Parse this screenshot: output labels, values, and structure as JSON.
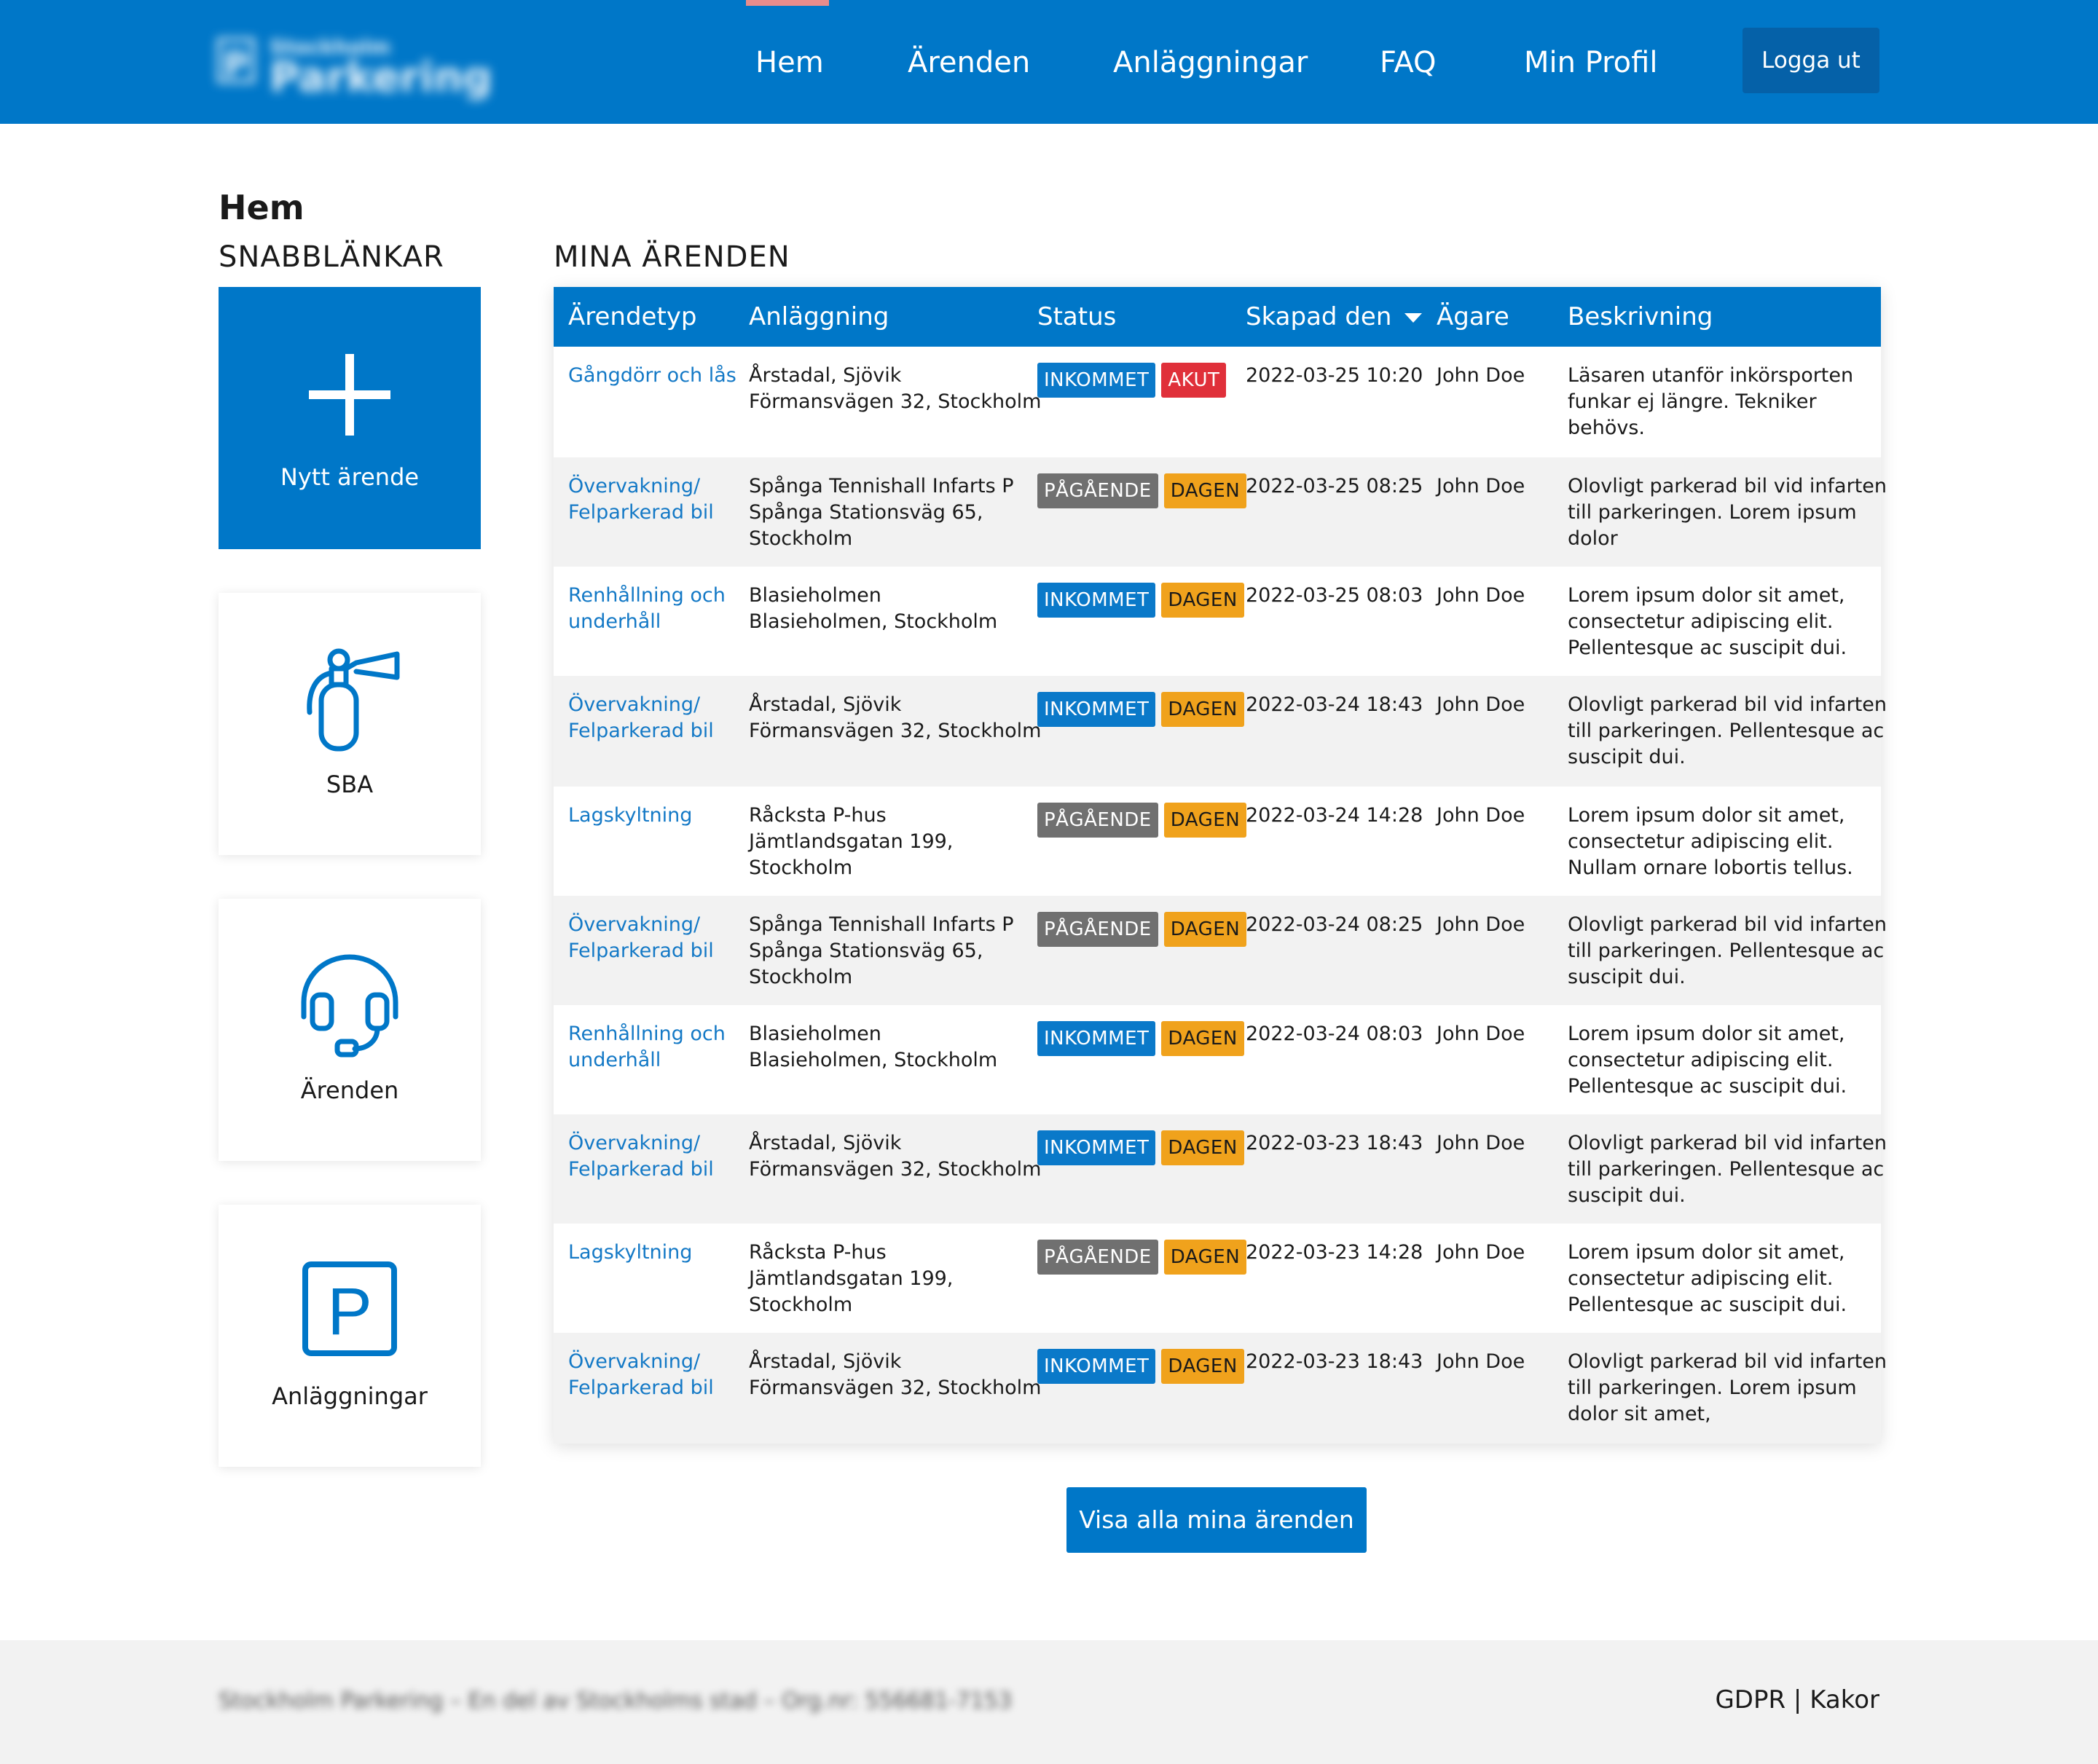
{
  "header": {
    "logo_small": "Stockholm",
    "logo_big": "Parkering",
    "logo_letter": "P",
    "nav": [
      {
        "label": "Hem",
        "active": true
      },
      {
        "label": "Ärenden"
      },
      {
        "label": "Anläggningar"
      },
      {
        "label": "FAQ"
      },
      {
        "label": "Min Profil"
      }
    ],
    "logout_label": "Logga ut"
  },
  "page": {
    "title": "Hem",
    "quicklinks_title": "SNABBLÄNKAR",
    "cases_title": "MINA ÄRENDEN"
  },
  "quicklinks": [
    {
      "label": "Nytt ärende",
      "icon": "plus-icon"
    },
    {
      "label": "SBA",
      "icon": "fire-extinguisher-icon"
    },
    {
      "label": "Ärenden",
      "icon": "headset-icon"
    },
    {
      "label": "Anläggningar",
      "icon": "parking-icon"
    }
  ],
  "table": {
    "headers": [
      "Ärendetyp",
      "Anläggning",
      "Status",
      "Skapad den",
      "Ägare",
      "Beskrivning"
    ],
    "sort_column": "Skapad den",
    "rows": [
      {
        "type": [
          "Gångdörr och lås"
        ],
        "facility": [
          "Årstadal, Sjövik",
          "Förmansvägen 32, Stockholm"
        ],
        "status": "INKOMMET",
        "priority": "AKUT",
        "created": "2022-03-25 10:20",
        "owner": "John Doe",
        "desc": [
          "Läsaren utanför inkörsporten",
          "funkar ej längre. Tekniker",
          "behövs."
        ]
      },
      {
        "type": [
          "Övervakning/",
          "Felparkerad bil"
        ],
        "facility": [
          "Spånga Tennishall Infarts P",
          "Spånga Stationsväg 65,",
          "Stockholm"
        ],
        "status": "PÅGÅENDE",
        "priority": "DAGEN",
        "created": "2022-03-25 08:25",
        "owner": "John Doe",
        "desc": [
          "Olovligt parkerad bil vid infarten",
          "till parkeringen. Lorem ipsum",
          "dolor"
        ]
      },
      {
        "type": [
          "Renhållning och",
          "underhåll"
        ],
        "facility": [
          "Blasieholmen",
          "Blasieholmen, Stockholm"
        ],
        "status": "INKOMMET",
        "priority": "DAGEN",
        "created": "2022-03-25 08:03",
        "owner": "John Doe",
        "desc": [
          "Lorem ipsum dolor sit amet,",
          "consectetur adipiscing elit.",
          "Pellentesque ac suscipit dui."
        ]
      },
      {
        "type": [
          "Övervakning/",
          "Felparkerad bil"
        ],
        "facility": [
          "Årstadal, Sjövik",
          "Förmansvägen 32, Stockholm"
        ],
        "status": "INKOMMET",
        "priority": "DAGEN",
        "created": "2022-03-24 18:43",
        "owner": "John Doe",
        "desc": [
          "Olovligt parkerad bil vid infarten",
          "till parkeringen. Pellentesque ac",
          "suscipit dui."
        ]
      },
      {
        "type": [
          "Lagskyltning"
        ],
        "facility": [
          "Råcksta P-hus",
          "Jämtlandsgatan 199,",
          "Stockholm"
        ],
        "status": "PÅGÅENDE",
        "priority": "DAGEN",
        "created": "2022-03-24 14:28",
        "owner": "John Doe",
        "desc": [
          "Lorem ipsum dolor sit amet,",
          "consectetur adipiscing elit.",
          "Nullam ornare lobortis tellus."
        ]
      },
      {
        "type": [
          "Övervakning/",
          "Felparkerad bil"
        ],
        "facility": [
          "Spånga Tennishall Infarts P",
          "Spånga Stationsväg 65,",
          "Stockholm"
        ],
        "status": "PÅGÅENDE",
        "priority": "DAGEN",
        "created": "2022-03-24 08:25",
        "owner": "John Doe",
        "desc": [
          "Olovligt parkerad bil vid infarten",
          "till parkeringen. Pellentesque ac",
          "suscipit dui."
        ]
      },
      {
        "type": [
          "Renhållning och",
          "underhåll"
        ],
        "facility": [
          "Blasieholmen",
          "Blasieholmen, Stockholm"
        ],
        "status": "INKOMMET",
        "priority": "DAGEN",
        "created": "2022-03-24 08:03",
        "owner": "John Doe",
        "desc": [
          "Lorem ipsum dolor sit amet,",
          "consectetur adipiscing elit.",
          "Pellentesque ac suscipit dui."
        ]
      },
      {
        "type": [
          "Övervakning/",
          "Felparkerad bil"
        ],
        "facility": [
          "Årstadal, Sjövik",
          "Förmansvägen 32, Stockholm"
        ],
        "status": "INKOMMET",
        "priority": "DAGEN",
        "created": "2022-03-23 18:43",
        "owner": "John Doe",
        "desc": [
          "Olovligt parkerad bil vid infarten",
          "till parkeringen. Pellentesque ac",
          "suscipit dui."
        ]
      },
      {
        "type": [
          "Lagskyltning"
        ],
        "facility": [
          "Råcksta P-hus",
          "Jämtlandsgatan 199,",
          "Stockholm"
        ],
        "status": "PÅGÅENDE",
        "priority": "DAGEN",
        "created": "2022-03-23 14:28",
        "owner": "John Doe",
        "desc": [
          "Lorem ipsum dolor sit amet,",
          "consectetur adipiscing elit.",
          "Pellentesque ac suscipit dui."
        ]
      },
      {
        "type": [
          "Övervakning/",
          "Felparkerad bil"
        ],
        "facility": [
          "Årstadal, Sjövik",
          "Förmansvägen 32, Stockholm"
        ],
        "status": "INKOMMET",
        "priority": "DAGEN",
        "created": "2022-03-23 18:43",
        "owner": "John Doe",
        "desc": [
          "Olovligt parkerad bil vid infarten",
          "till parkeringen. Lorem ipsum",
          "dolor sit amet,"
        ]
      }
    ]
  },
  "show_all_label": "Visa alla mina ärenden",
  "footer": {
    "text": "Stockholm Parkering – En del av Stockholms stad – Org.nr: 556681-7153",
    "link1": "GDPR",
    "separator": "|",
    "link2": "Kakor"
  },
  "colors": {
    "primary": "#0077c8",
    "status_inkommet": "#0a79c9",
    "status_pagaende": "#707070",
    "priority_akut": "#e0303a",
    "priority_dagen": "#f0a21c"
  }
}
